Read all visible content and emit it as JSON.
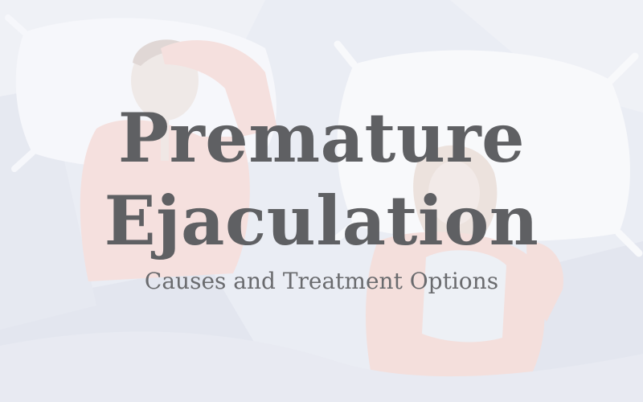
{
  "hero": {
    "title_line_1": "Premature",
    "title_line_2": "Ejaculation",
    "subtitle": "Causes and Treatment Options"
  },
  "illustration": {
    "description_icon": "couple-in-bed-illustration-icon"
  },
  "colors": {
    "background": "#e6e9f2",
    "title": "#5f6063",
    "subtitle": "#6a6b6e",
    "pillow": "#f4f5f9",
    "shirt": "#f3d9d6"
  }
}
